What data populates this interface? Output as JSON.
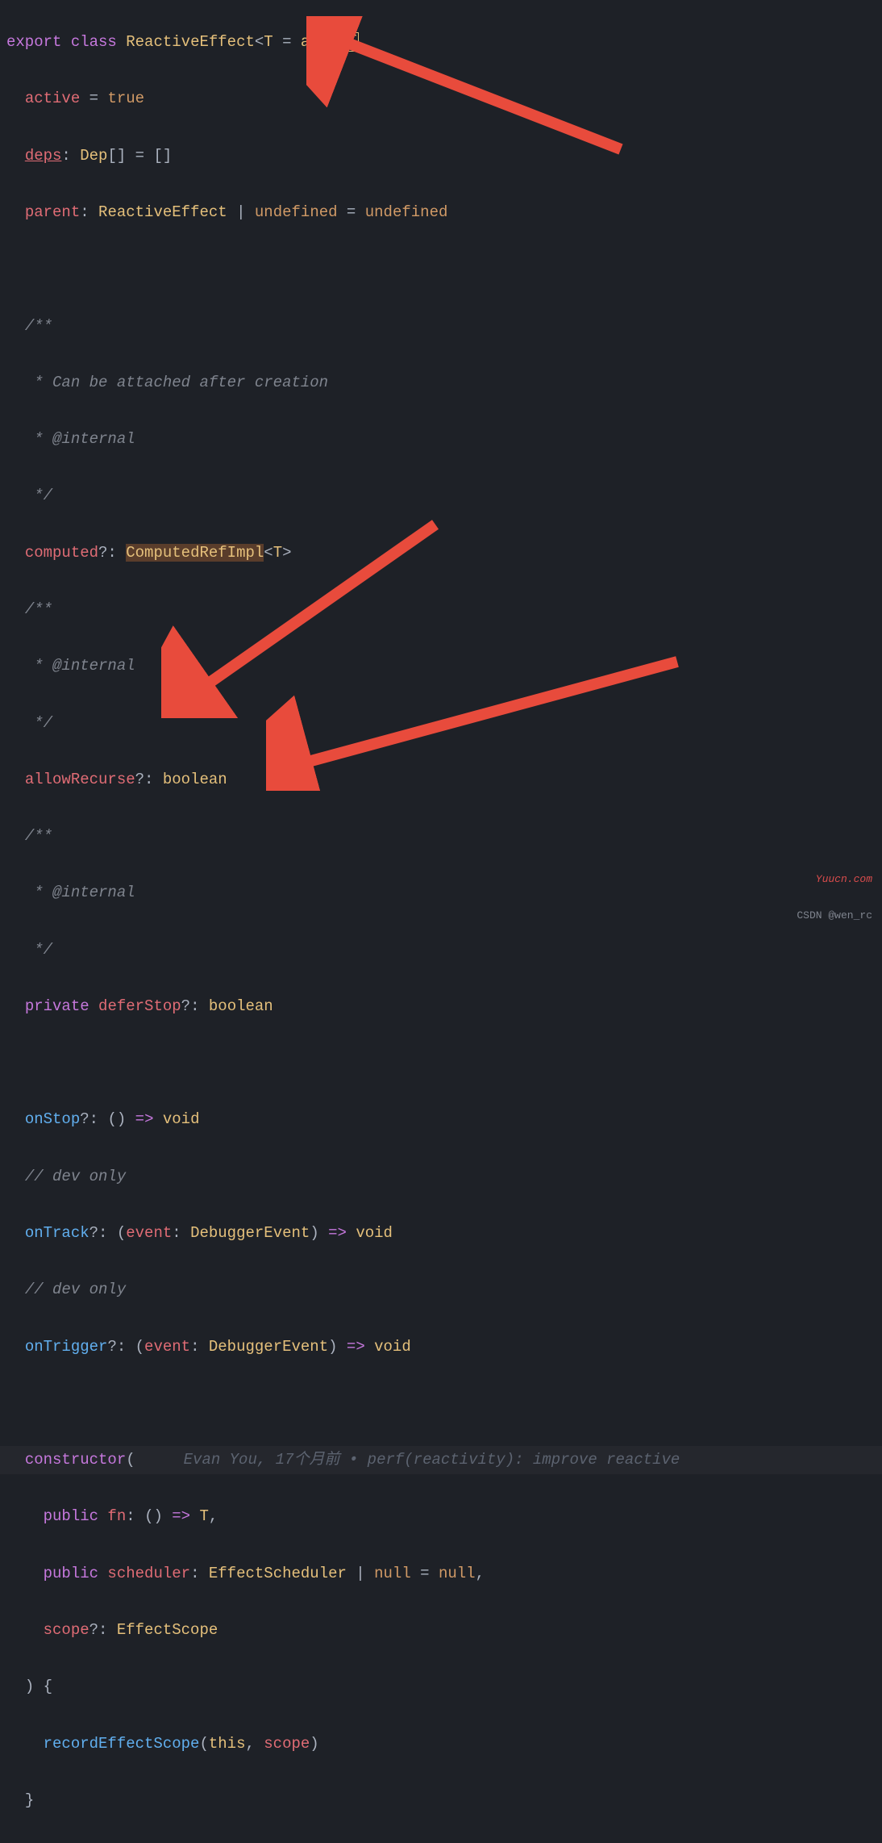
{
  "code": {
    "line1": {
      "export": "export",
      "class": "class",
      "name": "ReactiveEffect",
      "generic_open": "<",
      "generic_t": "T",
      "generic_eq": " = ",
      "generic_any": "any",
      "generic_close": ">",
      "brace": " {"
    },
    "line2": {
      "prop": "active",
      "eq": " = ",
      "val": "true"
    },
    "line3": {
      "prop": "deps",
      "colon": ": ",
      "type": "Dep",
      "brackets": "[] = []"
    },
    "line4": {
      "prop": "parent",
      "colon": ": ",
      "type": "ReactiveEffect",
      "pipe": " | ",
      "undef": "undefined",
      "eq": " = ",
      "val": "undefined"
    },
    "comment1_open": "/**",
    "comment1_l1": " * Can be attached after creation",
    "comment1_l2": " * @internal",
    "comment1_close": " */",
    "computed": {
      "prop": "computed",
      "q": "?: ",
      "type": "ComputedRefImpl",
      "open": "<",
      "t": "T",
      "close": ">"
    },
    "comment2_open": "/**",
    "comment2_l1": " * @internal",
    "comment2_close": " */",
    "allowRecurse": {
      "prop": "allowRecurse",
      "q": "?: ",
      "type": "boolean"
    },
    "comment3_open": "/**",
    "comment3_l1": " * @internal",
    "comment3_close": " */",
    "deferStop": {
      "priv": "private",
      "prop": " deferStop",
      "q": "?: ",
      "type": "boolean"
    },
    "onStop": {
      "prop": "onStop",
      "q": "?: ",
      "parens": "()",
      "arrow": " => ",
      "void": "void"
    },
    "devonly1": "// dev only",
    "onTrack": {
      "prop": "onTrack",
      "q": "?: (",
      "param": "event",
      "colon": ": ",
      "type": "DebuggerEvent",
      "close": ")",
      "arrow": " => ",
      "void": "void"
    },
    "devonly2": "// dev only",
    "onTrigger": {
      "prop": "onTrigger",
      "q": "?: (",
      "param": "event",
      "colon": ": ",
      "type": "DebuggerEvent",
      "close": ")",
      "arrow": " => ",
      "void": "void"
    },
    "constructor": {
      "kw": "constructor",
      "open": "("
    },
    "blame": "Evan You, 17个月前 • perf(reactivity): improve reactive",
    "fn_param": {
      "pub": "public",
      "name": " fn",
      "colon": ": ",
      "parens": "()",
      "arrow": " => ",
      "t": "T",
      "comma": ","
    },
    "scheduler_param": {
      "pub": "public",
      "name": " scheduler",
      "colon": ": ",
      "type": "EffectScheduler",
      "pipe": " | ",
      "null": "null",
      "eq": " = ",
      "val": "null",
      "comma": ","
    },
    "scope_param": {
      "name": "scope",
      "q": "?: ",
      "type": "EffectScope"
    },
    "ctor_close": ") {",
    "record": {
      "fn": "recordEffectScope",
      "open": "(",
      "this": "this",
      "comma": ", ",
      "scope": "scope",
      "close": ")"
    },
    "ctor_brace_close": "}"
  },
  "watermarks": {
    "yuucn": "Yuucn.com",
    "csdn": "CSDN @wen_rc"
  }
}
